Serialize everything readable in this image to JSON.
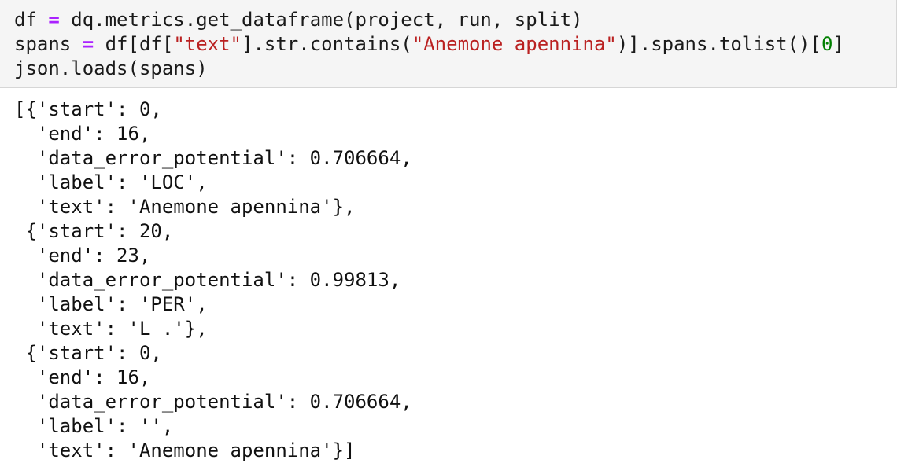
{
  "input_cell": {
    "lines": [
      [
        {
          "text": "df ",
          "kind": "plain"
        },
        {
          "text": "=",
          "kind": "op"
        },
        {
          "text": " dq.metrics.get_dataframe(project, run, split)",
          "kind": "plain"
        }
      ],
      [
        {
          "text": "spans ",
          "kind": "plain"
        },
        {
          "text": "=",
          "kind": "op"
        },
        {
          "text": " df[df[",
          "kind": "plain"
        },
        {
          "text": "\"text\"",
          "kind": "str"
        },
        {
          "text": "].str.contains(",
          "kind": "plain"
        },
        {
          "text": "\"Anemone apennina\"",
          "kind": "str"
        },
        {
          "text": ")].spans.tolist()[",
          "kind": "plain"
        },
        {
          "text": "0",
          "kind": "num"
        },
        {
          "text": "]",
          "kind": "plain"
        }
      ],
      [
        {
          "text": "json.loads(spans)",
          "kind": "plain"
        }
      ]
    ]
  },
  "output_cell": {
    "lines": [
      "[{'start': 0,",
      "  'end': 16,",
      "  'data_error_potential': 0.706664,",
      "  'label': 'LOC',",
      "  'text': 'Anemone apennina'},",
      " {'start': 20,",
      "  'end': 23,",
      "  'data_error_potential': 0.99813,",
      "  'label': 'PER',",
      "  'text': 'L .'},",
      " {'start': 0,",
      "  'end': 16,",
      "  'data_error_potential': 0.706664,",
      "  'label': '',",
      "  'text': 'Anemone apennina'}]"
    ]
  },
  "colors": {
    "input_background": "#f5f5f5",
    "operator": "#aa22ff",
    "string": "#ba2121",
    "number": "#008000"
  }
}
